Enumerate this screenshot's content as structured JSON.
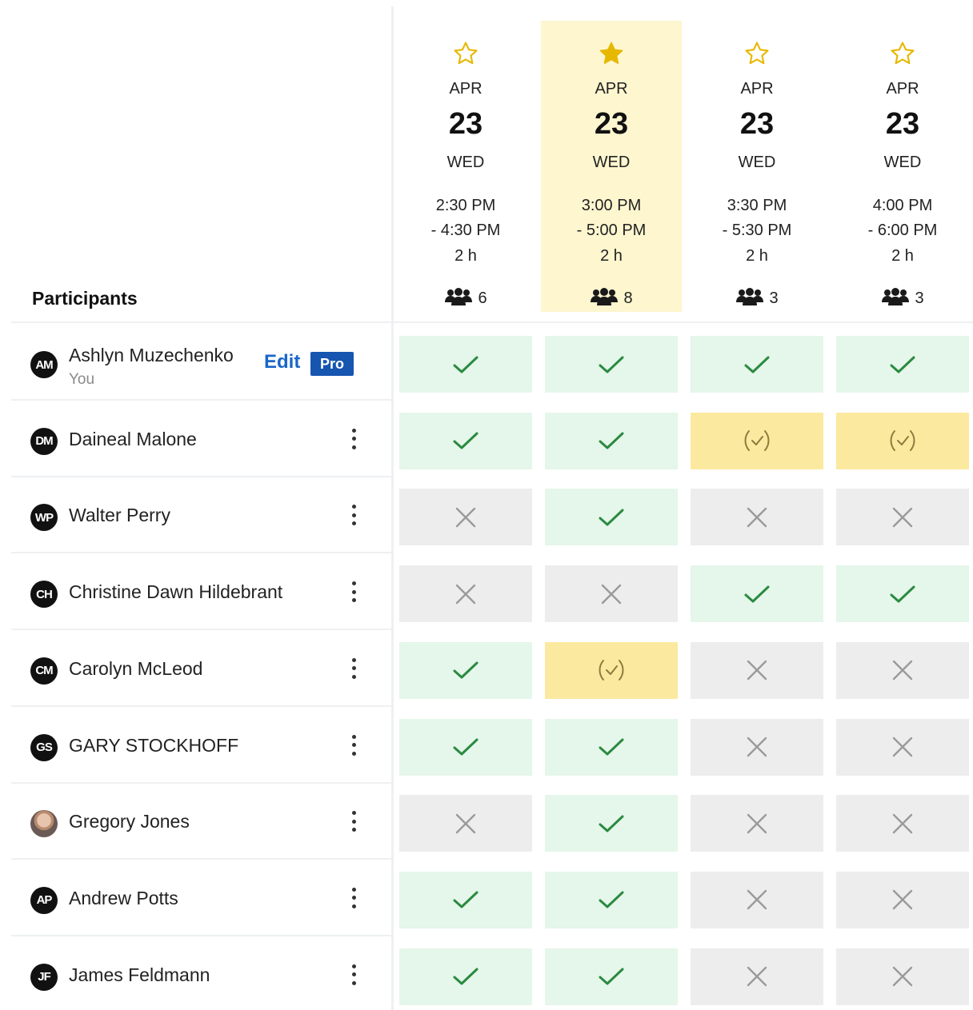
{
  "header": {
    "participants_label": "Participants"
  },
  "colors": {
    "yes": "#e5f6ea",
    "no": "#ededee",
    "maybe": "#fbe9a0",
    "highlight": "#fdf6cf",
    "check": "#2a8a40",
    "star_gold": "#e6b800",
    "link": "#1a66c9",
    "pro_badge": "#1655b0"
  },
  "options": [
    {
      "starred": false,
      "month": "APR",
      "day": "23",
      "weekday": "WED",
      "start": "2:30 PM",
      "end": "- 4:30 PM",
      "duration": "2 h",
      "count": "6",
      "highlight": false
    },
    {
      "starred": true,
      "month": "APR",
      "day": "23",
      "weekday": "WED",
      "start": "3:00 PM",
      "end": "- 5:00 PM",
      "duration": "2 h",
      "count": "8",
      "highlight": true
    },
    {
      "starred": false,
      "month": "APR",
      "day": "23",
      "weekday": "WED",
      "start": "3:30 PM",
      "end": "- 5:30 PM",
      "duration": "2 h",
      "count": "3",
      "highlight": false
    },
    {
      "starred": false,
      "month": "APR",
      "day": "23",
      "weekday": "WED",
      "start": "4:00 PM",
      "end": "- 6:00 PM",
      "duration": "2 h",
      "count": "3",
      "highlight": false
    }
  ],
  "participants": [
    {
      "initials": "AM",
      "name": "Ashlyn Muzechenko",
      "sub": "You",
      "edit_label": "Edit",
      "pro_label": "Pro",
      "is_self": true,
      "avatar_photo": false,
      "votes": [
        "yes",
        "yes",
        "yes",
        "yes"
      ]
    },
    {
      "initials": "DM",
      "name": "Daineal Malone",
      "votes": [
        "yes",
        "yes",
        "maybe",
        "maybe"
      ]
    },
    {
      "initials": "WP",
      "name": "Walter Perry",
      "votes": [
        "no",
        "yes",
        "no",
        "no"
      ]
    },
    {
      "initials": "CH",
      "name": "Christine Dawn Hildebrant",
      "votes": [
        "no",
        "no",
        "yes",
        "yes"
      ]
    },
    {
      "initials": "CM",
      "name": "Carolyn McLeod",
      "votes": [
        "yes",
        "maybe",
        "no",
        "no"
      ]
    },
    {
      "initials": "GS",
      "name": "GARY STOCKHOFF",
      "votes": [
        "yes",
        "yes",
        "no",
        "no"
      ]
    },
    {
      "initials": "",
      "name": "Gregory Jones",
      "avatar_photo": true,
      "votes": [
        "no",
        "yes",
        "no",
        "no"
      ]
    },
    {
      "initials": "AP",
      "name": "Andrew Potts",
      "votes": [
        "yes",
        "yes",
        "no",
        "no"
      ]
    },
    {
      "initials": "JF",
      "name": "James Feldmann",
      "votes": [
        "yes",
        "yes",
        "no",
        "no"
      ]
    }
  ],
  "icons": {
    "star_empty": "star-outline-icon",
    "star_filled": "star-filled-icon",
    "group": "participants-group-icon",
    "yes": "check-icon",
    "no": "cross-icon",
    "maybe": "check-in-parentheses-icon",
    "menu": "kebab-menu-icon"
  }
}
